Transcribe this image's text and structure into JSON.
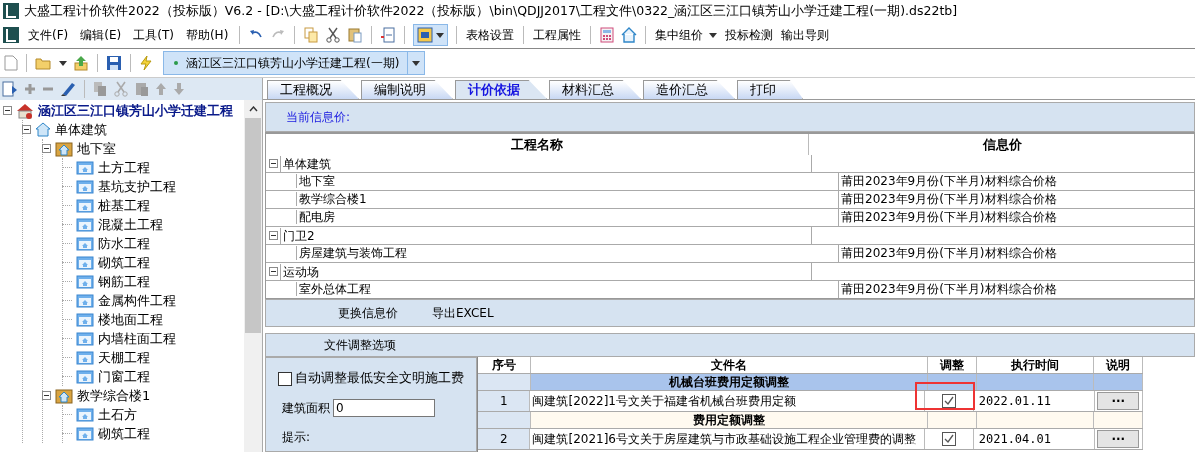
{
  "window": {
    "title": "大盛工程计价软件2022（投标版）V6.2 - [D:\\大盛工程计价软件2022（投标版）\\bin\\QDJJ2017\\工程文件\\0322_涵江区三江口镇芳山小学迁建工程(一期).ds22tb]"
  },
  "menu": [
    "文件(F)",
    "编辑(E)",
    "工具(T)",
    "帮助(H)"
  ],
  "toolbar_buttons": [
    {
      "label": "表格设置",
      "dropdown": false
    },
    {
      "label": "工程属性",
      "dropdown": false
    },
    {
      "label": "集中组价",
      "dropdown": true
    },
    {
      "label": "投标检测",
      "dropdown": false
    },
    {
      "label": "输出导则",
      "dropdown": false
    }
  ],
  "project_selector": {
    "value": "涵江区三江口镇芳山小学迁建工程(一期)"
  },
  "tree": [
    {
      "label": "涵江区三江口镇芳山小学迁建工程",
      "kind": "project",
      "expanded": true,
      "children": [
        {
          "label": "单体建筑",
          "kind": "building",
          "expanded": true,
          "children": [
            {
              "label": "地下室",
              "kind": "unit",
              "expanded": true,
              "children": [
                {
                  "label": "土方工程",
                  "kind": "folder"
                },
                {
                  "label": "基坑支护工程",
                  "kind": "folder"
                },
                {
                  "label": "桩基工程",
                  "kind": "folder"
                },
                {
                  "label": "混凝土工程",
                  "kind": "folder"
                },
                {
                  "label": "防水工程",
                  "kind": "folder"
                },
                {
                  "label": "砌筑工程",
                  "kind": "folder"
                },
                {
                  "label": "钢筋工程",
                  "kind": "folder"
                },
                {
                  "label": "金属构件工程",
                  "kind": "folder"
                },
                {
                  "label": "楼地面工程",
                  "kind": "folder"
                },
                {
                  "label": "内墙柱面工程",
                  "kind": "folder"
                },
                {
                  "label": "天棚工程",
                  "kind": "folder"
                },
                {
                  "label": "门窗工程",
                  "kind": "folder"
                }
              ]
            },
            {
              "label": "教学综合楼1",
              "kind": "unit",
              "expanded": true,
              "children": [
                {
                  "label": "土石方",
                  "kind": "folder"
                },
                {
                  "label": "砌筑工程",
                  "kind": "folder"
                }
              ]
            }
          ]
        }
      ]
    }
  ],
  "tabs": [
    {
      "label": "工程概况",
      "selected": false
    },
    {
      "label": "编制说明",
      "selected": false
    },
    {
      "label": "计价依据",
      "selected": true
    },
    {
      "label": "材料汇总",
      "selected": false
    },
    {
      "label": "造价汇总",
      "selected": false
    },
    {
      "label": "打印",
      "selected": false
    }
  ],
  "info_label": "当前信息价:",
  "info_table": {
    "columns": [
      "工程名称",
      "信息价"
    ],
    "rows": [
      {
        "name": "单体建筑",
        "price": "",
        "expanded": true,
        "children": [
          {
            "name": "地下室",
            "price": "莆田2023年9月份(下半月)材料综合价格"
          },
          {
            "name": "教学综合楼1",
            "price": "莆田2023年9月份(下半月)材料综合价格"
          },
          {
            "name": "配电房",
            "price": "莆田2023年9月份(下半月)材料综合价格"
          }
        ]
      },
      {
        "name": "门卫2",
        "price": "",
        "expanded": true,
        "children": [
          {
            "name": "房屋建筑与装饰工程",
            "price": "莆田2023年9月份(下半月)材料综合价格"
          }
        ]
      },
      {
        "name": "运动场",
        "price": "",
        "expanded": true,
        "children": [
          {
            "name": "室外总体工程",
            "price": "莆田2023年9月份(下半月)材料综合价格"
          }
        ]
      }
    ]
  },
  "info_actions": [
    "更换信息价",
    "导出EXCEL"
  ],
  "adjust_section": {
    "title": "文件调整选项",
    "auto_adjust": {
      "label": "自动调整最低安全文明施工费",
      "checked": false
    },
    "area": {
      "label": "建筑面积",
      "value": "0"
    },
    "hint": "提示:"
  },
  "file_grid": {
    "columns": [
      "序号",
      "文件名",
      "调整",
      "执行时间",
      "说明"
    ],
    "rows": [
      {
        "kind": "group",
        "title": "机械台班费用定额调整",
        "selected": true
      },
      {
        "kind": "file",
        "no": "1",
        "name": "闽建筑[2022]1号文关于福建省机械台班费用定额",
        "checked": true,
        "highlighted": true,
        "date": "2022.01.11",
        "detail": "···"
      },
      {
        "kind": "group",
        "title": "费用定额调整",
        "selected": false
      },
      {
        "kind": "file",
        "no": "2",
        "name": "闽建筑[2021]6号文关于房屋建筑与市政基础设施工程企业管理费的调整",
        "checked": true,
        "highlighted": false,
        "date": "2021.04.01",
        "detail": "···"
      }
    ]
  }
}
